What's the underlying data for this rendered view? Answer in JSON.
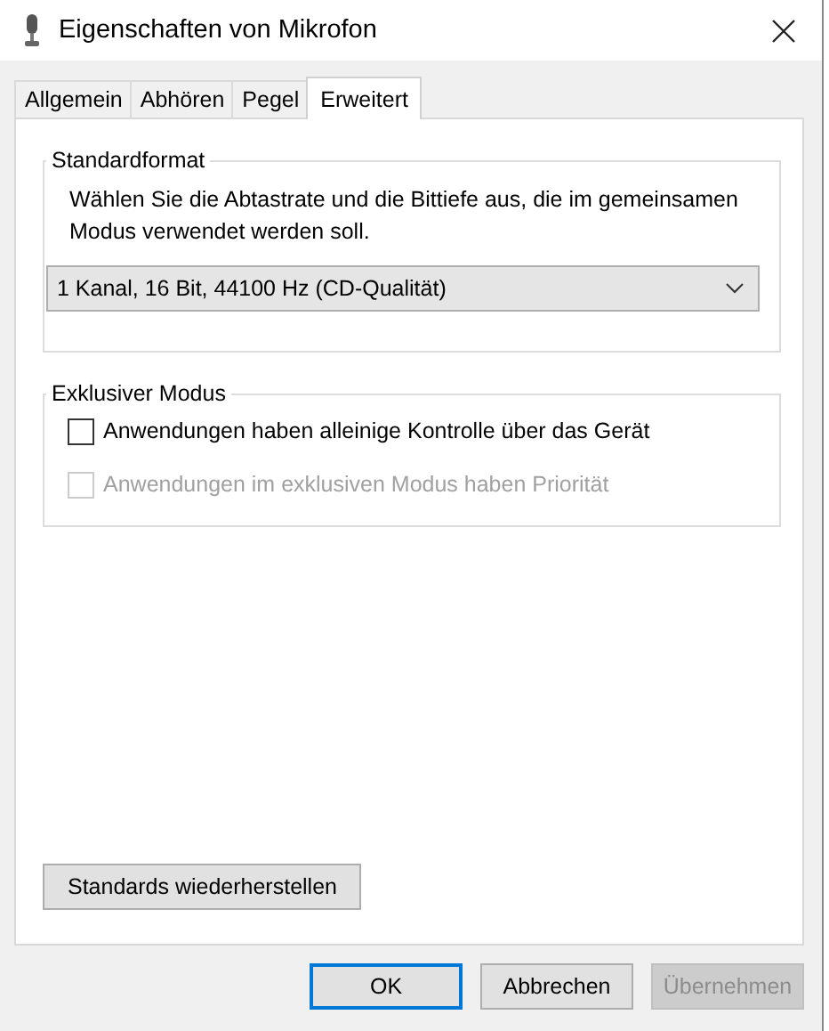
{
  "window": {
    "title": "Eigenschaften von Mikrofon"
  },
  "tabs": [
    {
      "label": "Allgemein",
      "selected": false
    },
    {
      "label": "Abhören",
      "selected": false
    },
    {
      "label": "Pegel",
      "selected": false
    },
    {
      "label": "Erweitert",
      "selected": true
    }
  ],
  "standard_format": {
    "title": "Standardformat",
    "description": "Wählen Sie die Abtastrate und die Bittiefe aus, die im gemeinsamen Modus verwendet werden soll.",
    "value": "1 Kanal, 16 Bit, 44100 Hz (CD-Qualität)"
  },
  "exclusive_mode": {
    "title": "Exklusiver Modus",
    "options": [
      {
        "label": "Anwendungen haben alleinige Kontrolle über das Gerät",
        "checked": false,
        "disabled": false
      },
      {
        "label": "Anwendungen im exklusiven Modus haben Priorität",
        "checked": false,
        "disabled": true
      }
    ]
  },
  "restore_button": "Standards wiederherstellen",
  "buttons": [
    {
      "label": "OK",
      "default": true,
      "disabled": false
    },
    {
      "label": "Abbrechen",
      "default": false,
      "disabled": false
    },
    {
      "label": "Übernehmen",
      "default": false,
      "disabled": true
    }
  ]
}
